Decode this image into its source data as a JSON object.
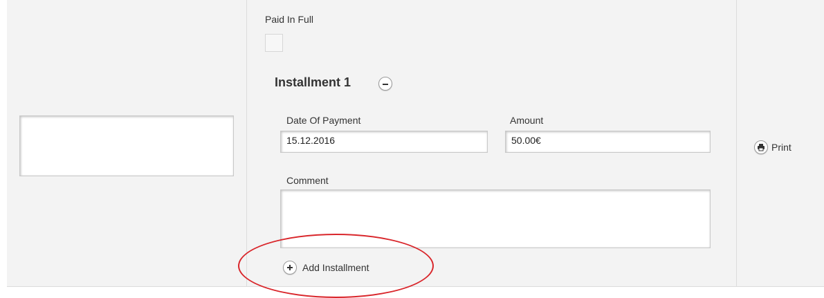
{
  "paid_in_full": {
    "label": "Paid In Full",
    "checked": false
  },
  "installment": {
    "title": "Installment 1",
    "date_label": "Date Of Payment",
    "date_value": "15.12.2016",
    "amount_label": "Amount",
    "amount_value": "50.00€",
    "comment_label": "Comment",
    "comment_value": ""
  },
  "add_installment_label": "Add Installment",
  "print_label": "Print",
  "icons": {
    "remove": "minus-circle-icon",
    "add": "plus-circle-icon",
    "print": "printer-icon"
  },
  "colors": {
    "annotation": "#d9262b",
    "row_background": "#f3f3f3"
  }
}
